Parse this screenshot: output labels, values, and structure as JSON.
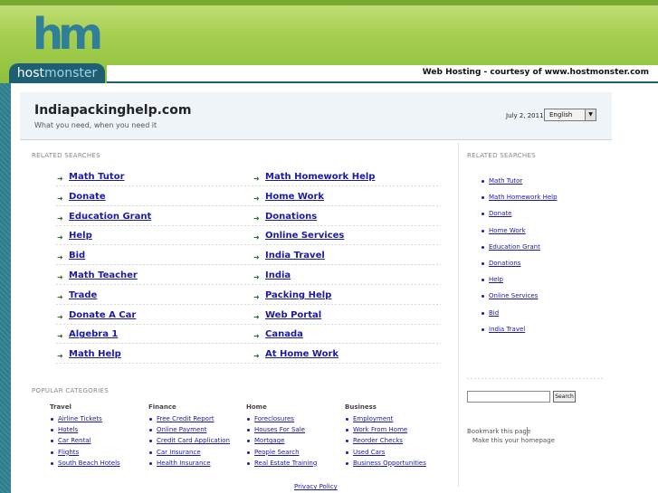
{
  "brand": {
    "logo_letters": "hm",
    "logo_host": "host",
    "logo_monster": "monster",
    "courtesy": "Web Hosting - courtesy of www.hostmonster.com",
    "accent": "#8ec03c",
    "brand_blue": "#1f5f73"
  },
  "site": {
    "title": "Indiapackinghelp.com",
    "tagline": "What you need, when you need it",
    "date": "July 2, 2011",
    "language": "English"
  },
  "related": {
    "label": "RELATED SEARCHES",
    "left": [
      "Math Tutor",
      "Donate",
      "Education Grant",
      "Help",
      "Bid",
      "Math Teacher",
      "Trade",
      "Donate A Car",
      "Algebra 1",
      "Math Help"
    ],
    "right": [
      "Math Homework Help",
      "Home Work",
      "Donations",
      "Online Services",
      "India Travel",
      "India",
      "Packing Help",
      "Web Portal",
      "Canada",
      "At Home Work"
    ]
  },
  "sidebar": {
    "label": "RELATED SEARCHES",
    "items": [
      "Math Tutor",
      "Math Homework Help",
      "Donate",
      "Home Work",
      "Education Grant",
      "Donations",
      "Help",
      "Online Services",
      "Bid",
      "India Travel"
    ],
    "search_button": "Search",
    "bookmark": "Bookmark this page",
    "homepage": "Make this your homepage"
  },
  "popular": {
    "label": "POPULAR CATEGORIES",
    "categories": [
      {
        "name": "Travel",
        "links": [
          "Airline Tickets",
          "Hotels",
          "Car Rental",
          "Flights",
          "South Beach Hotels"
        ]
      },
      {
        "name": "Finance",
        "links": [
          "Free Credit Report",
          "Online Payment",
          "Credit Card Application",
          "Car Insurance",
          "Health Insurance"
        ]
      },
      {
        "name": "Home",
        "links": [
          "Foreclosures",
          "Houses For Sale",
          "Mortgage",
          "People Search",
          "Real Estate Training"
        ]
      },
      {
        "name": "Business",
        "links": [
          "Employment",
          "Work From Home",
          "Reorder Checks",
          "Used Cars",
          "Business Opportunities"
        ]
      }
    ]
  },
  "footer": {
    "privacy": "Privacy Policy"
  }
}
